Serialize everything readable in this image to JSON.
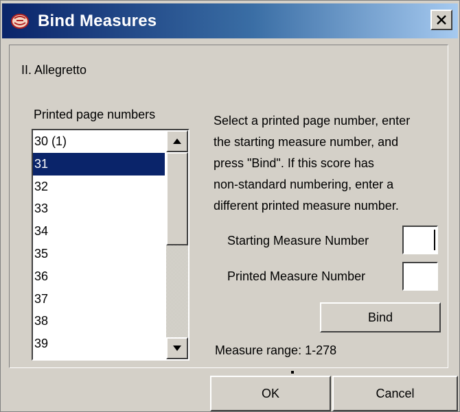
{
  "window": {
    "title": "Bind Measures",
    "close_label": "×"
  },
  "movement_label": "II.  Allegretto",
  "list": {
    "label": "Printed page numbers",
    "items": [
      "30 (1)",
      "31",
      "32",
      "33",
      "34",
      "35",
      "36",
      "37",
      "38",
      "39"
    ],
    "selected_index": 1
  },
  "instructions": {
    "lines": [
      "Select a printed page number, enter",
      "the starting measure number, and",
      "press \"Bind\".  If this score has",
      "non-standard numbering, enter a",
      "different printed measure number."
    ]
  },
  "fields": {
    "starting_label": "Starting Measure Number",
    "starting_value": "",
    "printed_label": "Printed Measure Number",
    "printed_value": ""
  },
  "buttons": {
    "bind": "Bind",
    "ok": "OK",
    "cancel": "Cancel"
  },
  "measure_range": "Measure range:  1-278",
  "colors": {
    "selection": "#0a246a",
    "face": "#d4d0c8",
    "title_start": "#0a246a",
    "title_end": "#a6caf0"
  }
}
